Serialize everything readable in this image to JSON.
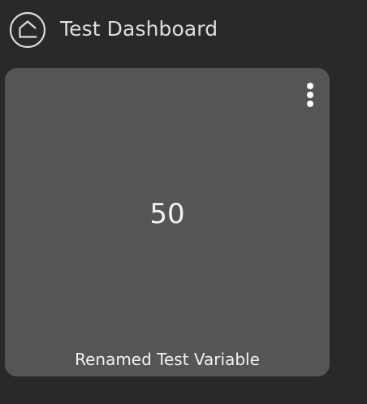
{
  "header": {
    "home_icon": "home-icon",
    "title": "Test Dashboard"
  },
  "widget": {
    "value": "50",
    "label": "Renamed Test Variable",
    "menu_icon": "kebab-menu-icon"
  },
  "colors": {
    "background": "#292929",
    "card": "#555555",
    "text": "#f3f3f3"
  }
}
